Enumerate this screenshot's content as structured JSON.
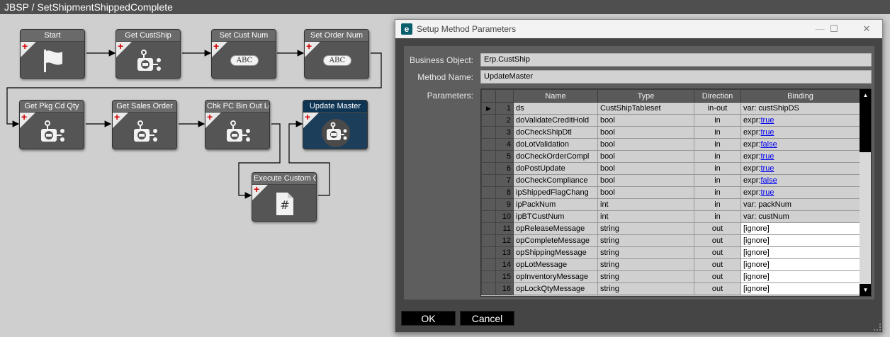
{
  "app": {
    "title": "JBSP / SetShipmentShippedComplete"
  },
  "workflow": {
    "nodes": [
      {
        "label": "Start",
        "icon": "flag-icon"
      },
      {
        "label": "Get CustShip",
        "icon": "service-call-icon"
      },
      {
        "label": "Set Cust Num",
        "icon": "set-argument-icon",
        "badge": "ABC"
      },
      {
        "label": "Set Order Num",
        "icon": "set-argument-icon",
        "badge": "ABC"
      },
      {
        "label": "Get Pkg Cd Qty",
        "icon": "service-call-icon"
      },
      {
        "label": "Get Sales Order",
        "icon": "service-call-icon"
      },
      {
        "label": "Chk PC Bin Out Lo",
        "icon": "service-call-icon"
      },
      {
        "label": "Update Master",
        "icon": "service-call-icon"
      },
      {
        "label": "Execute Custom Co",
        "icon": "custom-code-icon",
        "badge": "#"
      }
    ],
    "plus_glyph": "+"
  },
  "dialog": {
    "title": "Setup Method Parameters",
    "logo_glyph": "e",
    "controls": {
      "minimize": "—",
      "maximize": "☐",
      "close": "✕"
    },
    "business_object_label": "Business Object:",
    "business_object_value": "Erp.CustShip",
    "method_name_label": "Method Name:",
    "method_name_value": "UpdateMaster",
    "parameters_label": "Parameters:",
    "columns": [
      "Name",
      "Type",
      "Direction",
      "Binding"
    ],
    "rows": [
      {
        "n": "1",
        "name": "ds",
        "type": "CustShipTableset",
        "dir": "in-out",
        "bind_prefix": "var: custShipDS",
        "bind_link": ""
      },
      {
        "n": "2",
        "name": "doValidateCreditHold",
        "type": "bool",
        "dir": "in",
        "bind_prefix": "expr:",
        "bind_link": "true"
      },
      {
        "n": "3",
        "name": "doCheckShipDtl",
        "type": "bool",
        "dir": "in",
        "bind_prefix": "expr:",
        "bind_link": "true"
      },
      {
        "n": "4",
        "name": "doLotValidation",
        "type": "bool",
        "dir": "in",
        "bind_prefix": "expr:",
        "bind_link": "false"
      },
      {
        "n": "5",
        "name": "doCheckOrderCompl",
        "type": "bool",
        "dir": "in",
        "bind_prefix": "expr:",
        "bind_link": "true"
      },
      {
        "n": "6",
        "name": "doPostUpdate",
        "type": "bool",
        "dir": "in",
        "bind_prefix": "expr:",
        "bind_link": "true"
      },
      {
        "n": "7",
        "name": "doCheckCompliance",
        "type": "bool",
        "dir": "in",
        "bind_prefix": "expr:",
        "bind_link": "false"
      },
      {
        "n": "8",
        "name": "ipShippedFlagChang",
        "type": "bool",
        "dir": "in",
        "bind_prefix": "expr:",
        "bind_link": "true"
      },
      {
        "n": "9",
        "name": "ipPackNum",
        "type": "int",
        "dir": "in",
        "bind_prefix": "var: packNum",
        "bind_link": ""
      },
      {
        "n": "10",
        "name": "ipBTCustNum",
        "type": "int",
        "dir": "in",
        "bind_prefix": "var: custNum",
        "bind_link": ""
      },
      {
        "n": "11",
        "name": "opReleaseMessage",
        "type": "string",
        "dir": "out",
        "bind_prefix": "[ignore]",
        "bind_link": ""
      },
      {
        "n": "12",
        "name": "opCompleteMessage",
        "type": "string",
        "dir": "out",
        "bind_prefix": "[ignore]",
        "bind_link": ""
      },
      {
        "n": "13",
        "name": "opShippingMessage",
        "type": "string",
        "dir": "out",
        "bind_prefix": "[ignore]",
        "bind_link": ""
      },
      {
        "n": "14",
        "name": "opLotMessage",
        "type": "string",
        "dir": "out",
        "bind_prefix": "[ignore]",
        "bind_link": ""
      },
      {
        "n": "15",
        "name": "opInventoryMessage",
        "type": "string",
        "dir": "out",
        "bind_prefix": "[ignore]",
        "bind_link": ""
      },
      {
        "n": "16",
        "name": "opLockQtyMessage",
        "type": "string",
        "dir": "out",
        "bind_prefix": "[ignore]",
        "bind_link": ""
      }
    ],
    "selected_row_marker": "▶",
    "scroll_up": "▲",
    "scroll_down": "▼",
    "ok_label": "OK",
    "cancel_label": "Cancel"
  }
}
